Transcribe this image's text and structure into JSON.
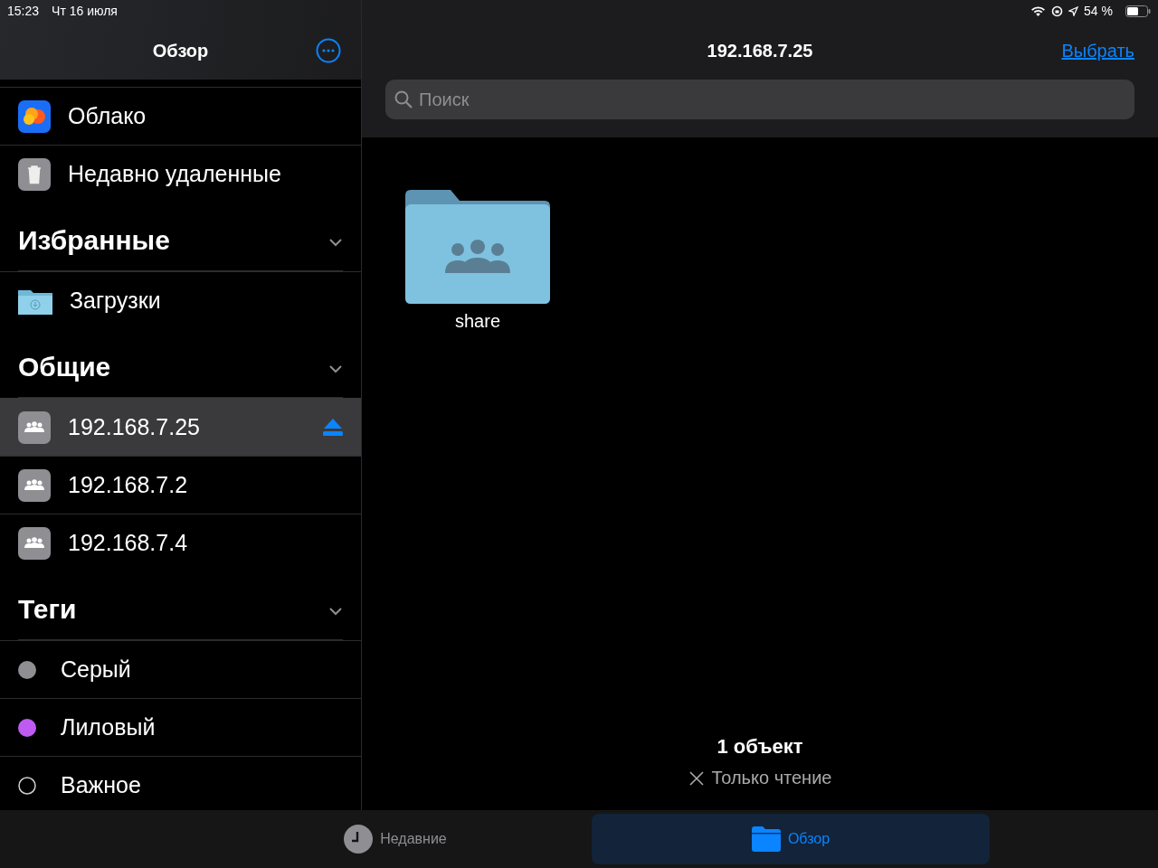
{
  "status_bar": {
    "time": "15:23",
    "date": "Чт 16 июля",
    "battery": "54 %"
  },
  "sidebar": {
    "title": "Обзор",
    "sections": [
      {
        "items": [
          {
            "kind": "cloud",
            "label": "Облако"
          },
          {
            "kind": "trash",
            "label": "Недавно удаленные"
          }
        ]
      },
      {
        "title": "Избранные",
        "expanded": true,
        "items": [
          {
            "kind": "downloads",
            "label": "Загрузки"
          }
        ]
      },
      {
        "title": "Общие",
        "expanded": true,
        "items": [
          {
            "kind": "server",
            "label": "192.168.7.25",
            "selected": true,
            "eject": true
          },
          {
            "kind": "server",
            "label": "192.168.7.2",
            "selected": false,
            "eject": false
          },
          {
            "kind": "server",
            "label": "192.168.7.4",
            "selected": false,
            "eject": false
          }
        ]
      },
      {
        "title": "Теги",
        "expanded": true,
        "items": [
          {
            "kind": "tag",
            "label": "Серый",
            "color": "#8e8e93"
          },
          {
            "kind": "tag",
            "label": "Лиловый",
            "color": "#bf5af2"
          },
          {
            "kind": "tag-empty",
            "label": "Важное"
          }
        ]
      }
    ]
  },
  "main": {
    "title": "192.168.7.25",
    "select_button": "Выбрать",
    "search": {
      "placeholder": "Поиск"
    },
    "items": [
      {
        "kind": "shared-folder",
        "label": "share"
      }
    ],
    "footer": {
      "count": "1 объект",
      "access": "Только чтение"
    }
  },
  "tab_bar": [
    {
      "label": "Недавние",
      "kind": "recent",
      "selected": false
    },
    {
      "label": "Обзор",
      "kind": "browse",
      "selected": true
    }
  ]
}
